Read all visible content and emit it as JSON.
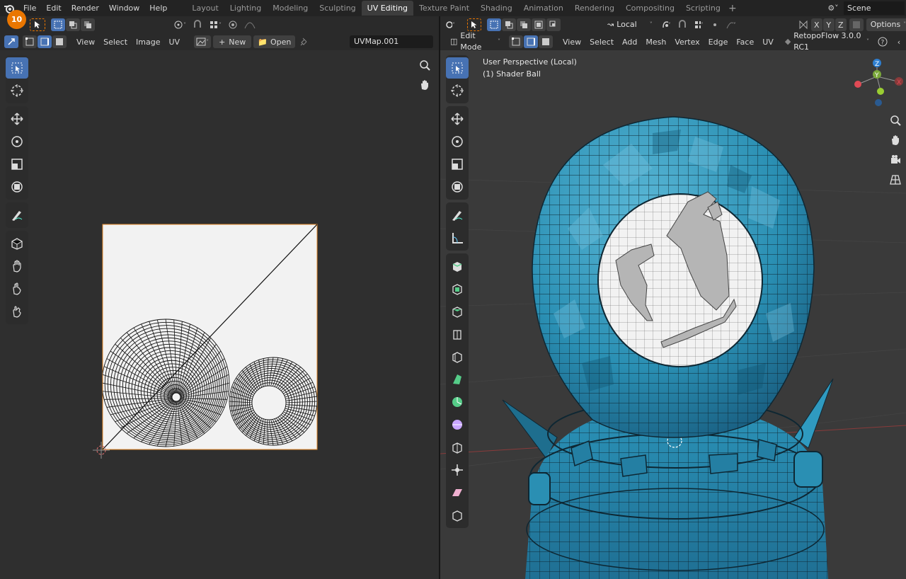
{
  "menu": [
    "File",
    "Edit",
    "Render",
    "Window",
    "Help"
  ],
  "workspaces": [
    {
      "label": "Layout",
      "active": false
    },
    {
      "label": "Lighting",
      "active": false
    },
    {
      "label": "Modeling",
      "active": false
    },
    {
      "label": "Sculpting",
      "active": false
    },
    {
      "label": "UV Editing",
      "active": true
    },
    {
      "label": "Texture Paint",
      "active": false
    },
    {
      "label": "Shading",
      "active": false
    },
    {
      "label": "Animation",
      "active": false
    },
    {
      "label": "Rendering",
      "active": false
    },
    {
      "label": "Compositing",
      "active": false
    },
    {
      "label": "Scripting",
      "active": false
    }
  ],
  "undo_count": "10",
  "scene_name": "Scene",
  "uv_editor": {
    "menus": [
      "View",
      "Select",
      "Image",
      "UV"
    ],
    "new_label": "New",
    "open_label": "Open",
    "uv_map": "UVMap.001"
  },
  "viewport": {
    "mode": "Edit Mode",
    "menus": [
      "View",
      "Select",
      "Add",
      "Mesh",
      "Vertex",
      "Edge",
      "Face",
      "UV"
    ],
    "addon": "RetopoFlow 3.0.0 RC1",
    "pivot": "Local",
    "mirror_axes": [
      "X",
      "Y",
      "Z"
    ],
    "options_label": "Options",
    "perspective_text": "User Perspective (Local)",
    "object_text": "(1) Shader Ball"
  },
  "colors": {
    "accent_blue": "#4772b3",
    "undo_orange": "#ea7600",
    "mesh_blue": "#2a8fb3"
  }
}
